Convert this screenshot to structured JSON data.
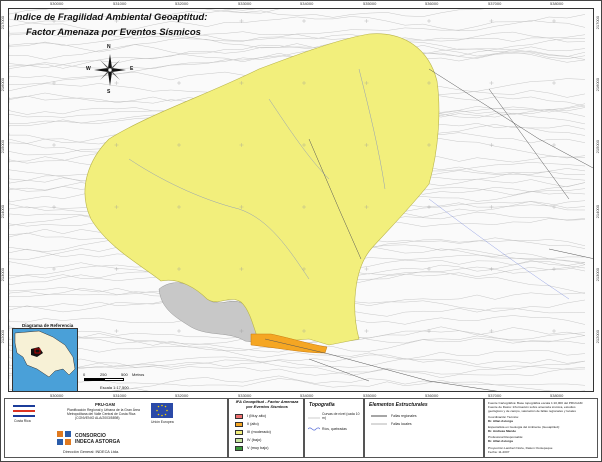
{
  "title": {
    "line1": "Indice de Fragilidad Ambiental Geoaptitud:",
    "line2": "Factor Amenaza por Eventos Sísmicos"
  },
  "compass": {
    "n": "N",
    "s": "S",
    "e": "E",
    "w": "W"
  },
  "grid": {
    "x_ticks": [
      "530000",
      "531000",
      "532000",
      "533000",
      "534000",
      "535000",
      "536000",
      "537000",
      "538000"
    ],
    "y_ticks": [
      "212000",
      "213000",
      "214000",
      "215000",
      "216000",
      "217000"
    ]
  },
  "inset": {
    "title": "Diagrama de Referencia"
  },
  "scale": {
    "labels": [
      "0",
      "250",
      "500",
      "Metros"
    ],
    "caption": "Escala 1:17,500"
  },
  "legend": {
    "title": "IFA Geoaptitud - Factor Amenaza por Eventos Sísmicos",
    "classes": [
      {
        "label": "I (Muy alto)",
        "color": "#f07070"
      },
      {
        "label": "II (alto)",
        "color": "#f5a623"
      },
      {
        "label": "III (moderado)",
        "color": "#f2ef7c"
      },
      {
        "label": "IV (bajo)",
        "color": "#c8e6a0"
      },
      {
        "label": "V (muy bajo)",
        "color": "#3a9a3a"
      }
    ]
  },
  "topografia": {
    "title": "Topografía",
    "curvas": "Curvas de nivel (cada 10 m)",
    "rios": "Ríos, quebradas"
  },
  "estructurales": {
    "title": "Elementos Estructurales",
    "fallas_regionales": "Fallas regionales",
    "fallas_locales": "Fallas locales"
  },
  "logos": {
    "pri_gam_title": "PRU-GAM",
    "pri_gam_desc": [
      "Planificación Regional y Urbana de la Gran Área",
      "Metropolitana del Valle Central de Costa Rica",
      "(CONVENIO ALA/2003/5898)"
    ],
    "costa_rica": "Costa Rica",
    "eu_label": "Unión Europea",
    "consorcio": [
      "CONSORCIO",
      "INDECA ASTORGA"
    ],
    "direccion": "Dirección General: INDECA Ltda."
  },
  "info": {
    "lines": [
      "Fuente Cartográfica: Base topográfica escala 1:10,000 del PRUGAM",
      "Fuente de Datos: Información sobre amenaza sísmica, estudios",
      "geológicos y de campo, valoración de fallas regionales y locales",
      "Coordinación Técnica:",
      "Dr. Allan Astorga",
      "Especialista en Geología del Ambiente (Geoaptitud):",
      "Dr. Andreas Mende",
      "Profesional Responsable:",
      "Dr. Allan Astorga",
      "Proyección Lambert Norte, Datum Ocotepeque",
      "Fecha: 11-2007"
    ]
  },
  "colors": {
    "zone_iii": "#f2ef7c",
    "zone_ii": "#f5a623",
    "rock_gray": "#c8c8c8",
    "contour": "#bdbdbd",
    "river": "#5a6fd8"
  }
}
